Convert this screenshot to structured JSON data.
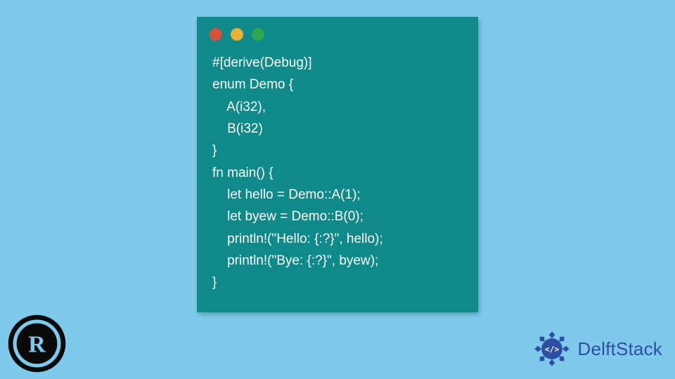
{
  "window": {
    "dots": [
      "red",
      "yellow",
      "green"
    ]
  },
  "code": {
    "lines": [
      "#[derive(Debug)]",
      "enum Demo {",
      "    A(i32),",
      "    B(i32)",
      "}",
      "fn main() {",
      "    let hello = Demo::A(1);",
      "    let byew = Demo::B(0);",
      "    println!(\"Hello: {:?}\", hello);",
      "    println!(\"Bye: {:?}\", byew);",
      "}"
    ]
  },
  "branding": {
    "left_logo": "rust",
    "right_text": "DelftStack"
  }
}
